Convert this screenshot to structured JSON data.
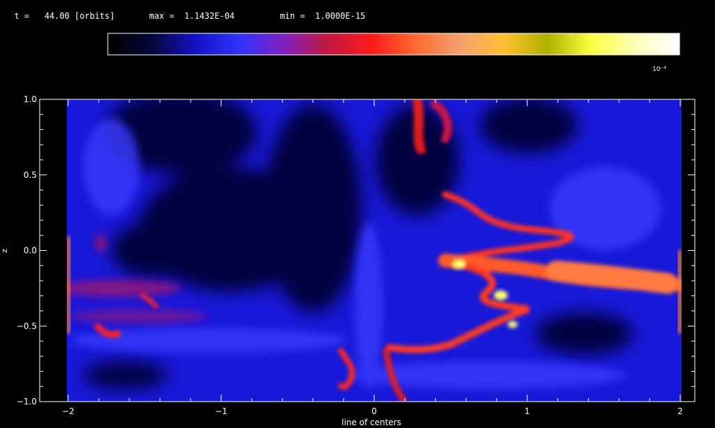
{
  "header": {
    "time_prefix": "t =",
    "time_value": "44.00",
    "time_unit": "[orbits]",
    "max_label": "max =",
    "max_value": "1.1432E-04",
    "min_label": "min =",
    "min_value": "1.0000E-15"
  },
  "colorbar": {
    "scale_label": "10⁻⁴",
    "stops": [
      "#000000",
      "#06063a",
      "#1212c8",
      "#3232ff",
      "#8020c0",
      "#c01840",
      "#ff1a1a",
      "#ff6a30",
      "#f4a070",
      "#ffc030",
      "#b0b000",
      "#ffff40",
      "#ffffb8",
      "#ffffff"
    ]
  },
  "plot": {
    "ylabel": "z",
    "xlabel": "line of centers",
    "xlim": [
      -2,
      2
    ],
    "ylim": [
      -1,
      1
    ],
    "xticks": [
      "−2",
      "−1",
      "0",
      "1",
      "2"
    ],
    "yticks": [
      "−1.0",
      "−0.5",
      "0.0",
      "0.5",
      "1.0"
    ],
    "field_colors": {
      "background": "#000000",
      "low": "#1818d8",
      "mid": "#3a3aff",
      "dark": "#040438",
      "hot": "#ff2020",
      "warm": "#ff6a30",
      "peak": "#ffff70"
    }
  }
}
